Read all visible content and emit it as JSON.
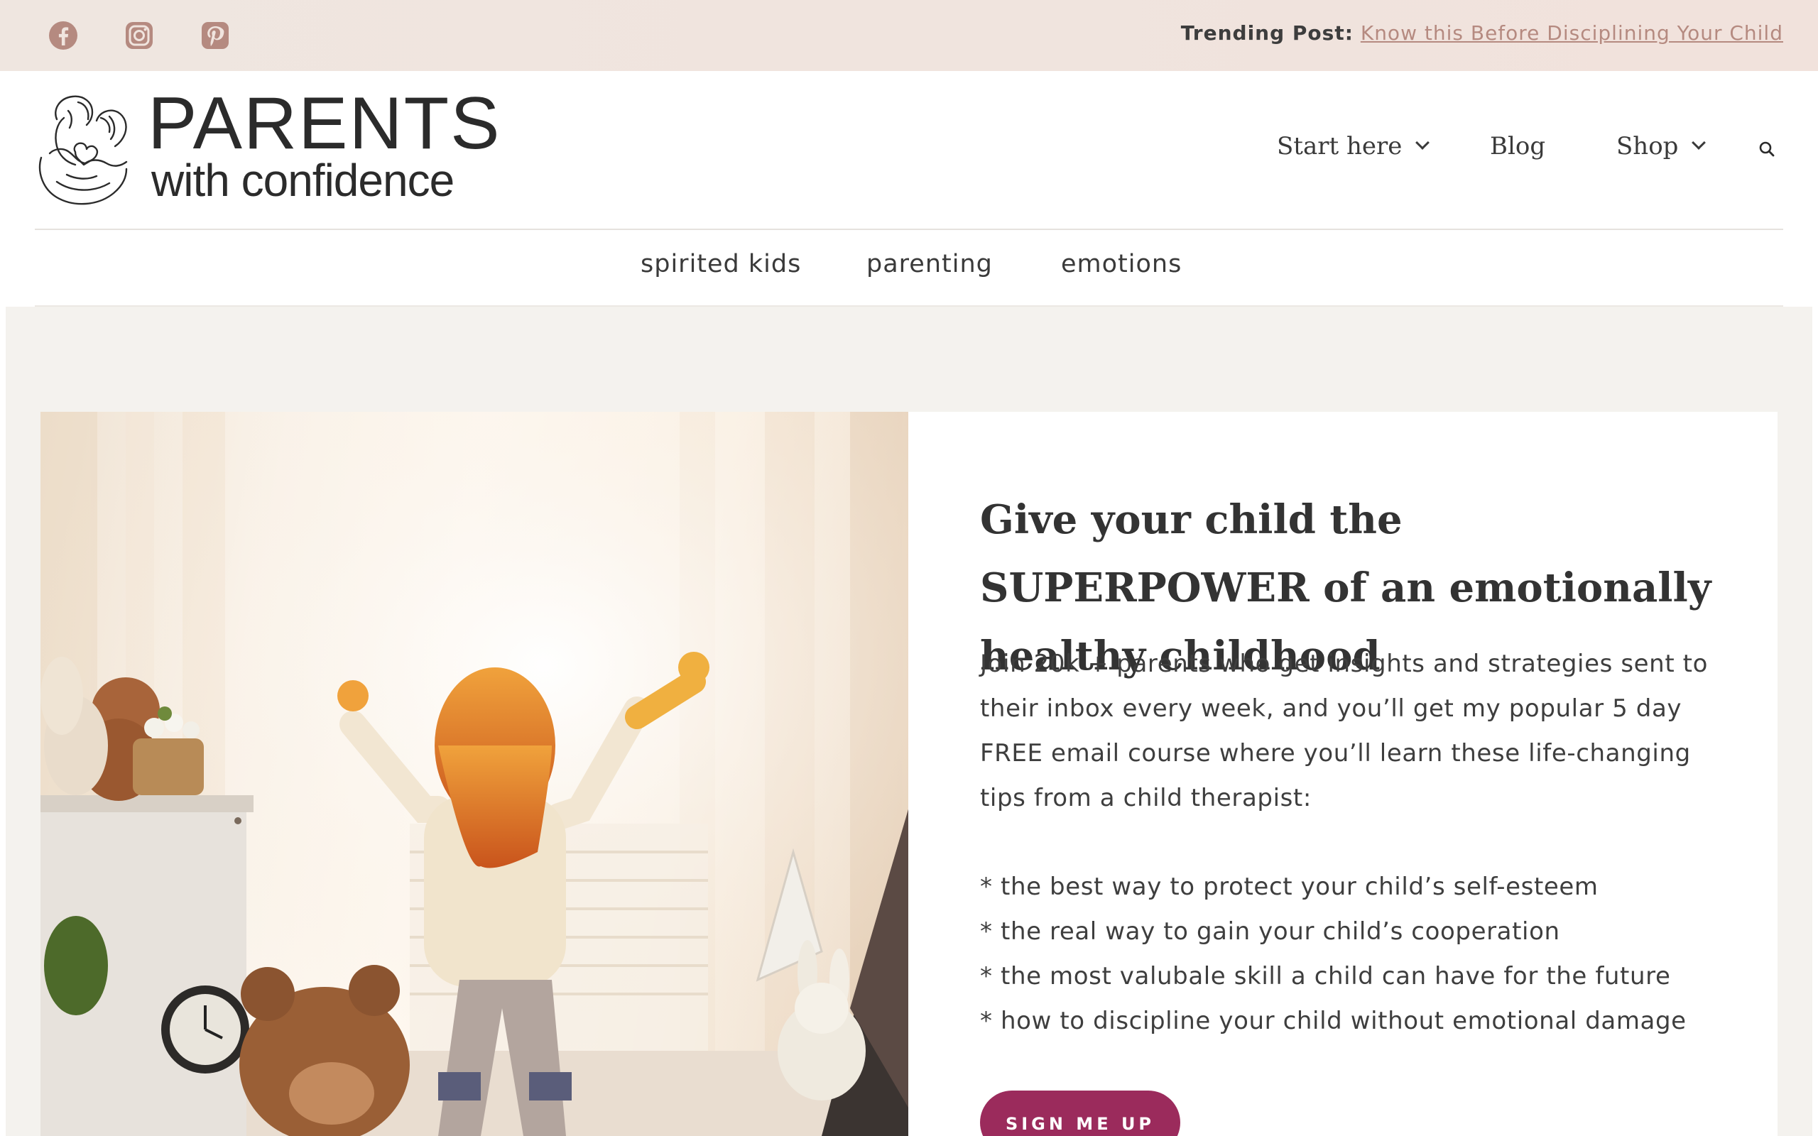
{
  "topbar": {
    "social": [
      {
        "name": "facebook",
        "icon": "facebook-icon"
      },
      {
        "name": "instagram",
        "icon": "instagram-icon"
      },
      {
        "name": "pinterest",
        "icon": "pinterest-icon"
      }
    ],
    "trending_label": "Trending Post:",
    "trending_link": "Know this Before Disciplining Your Child"
  },
  "brand": {
    "line1": "PARENTS",
    "line2": "with confidence"
  },
  "main_nav": {
    "start_here": "Start here",
    "blog": "Blog",
    "shop": "Shop"
  },
  "sub_nav": {
    "items": [
      "spirited kids",
      "parenting",
      "emotions"
    ]
  },
  "hero": {
    "title": "Give your child the SUPERPOWER of an emotionally healthy childhood",
    "body": "Join 20k + parents who get insights and strategies sent to their inbox every week, and you’ll get my popular 5 day FREE email course where you’ll learn these life-changing tips from a child therapist:",
    "bullets": [
      "* the best way to protect your child’s self-esteem",
      "* the real way to gain your child’s cooperation",
      "* the most valubale skill a child can have for the future",
      "* how to discipline your child without emotional damage"
    ],
    "cta": "SIGN ME UP"
  },
  "colors": {
    "accent": "#9b2b5c",
    "topbar_bg": "#f0e4de",
    "link": "#b58a80",
    "icon": "#b58a80"
  }
}
